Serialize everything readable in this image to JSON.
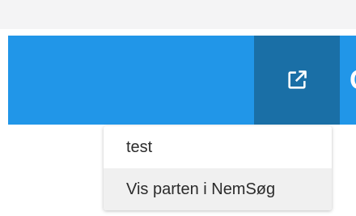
{
  "header": {
    "open_external_icon": "open-in-new-icon",
    "edge_glyph": "C"
  },
  "menu": {
    "items": [
      {
        "label": "test"
      },
      {
        "label": "Vis parten i NemSøg"
      }
    ],
    "hovered_index": 1
  },
  "colors": {
    "toolbar": "#2196e8",
    "action_button": "#1a6fa6",
    "menu_hover": "#f0f0f0"
  }
}
